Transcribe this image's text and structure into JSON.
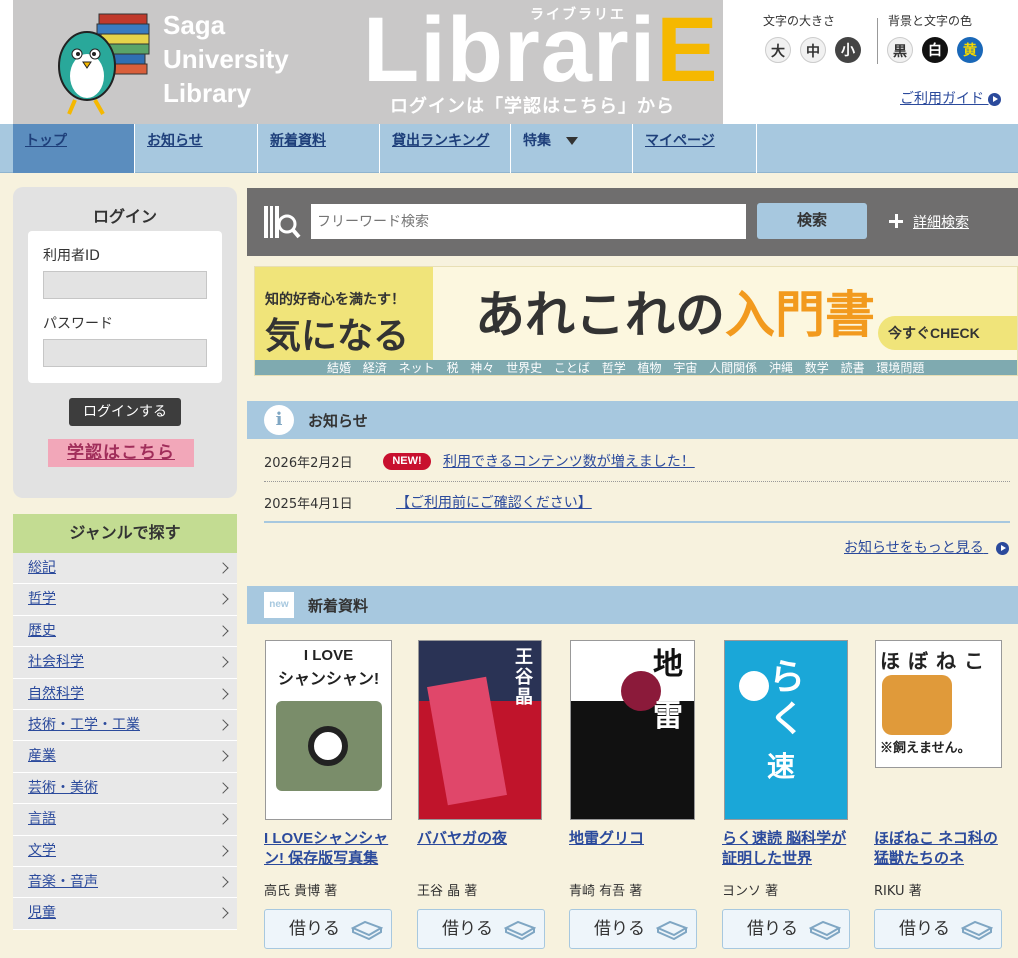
{
  "header": {
    "library_name": [
      "Saga",
      "University",
      "Library"
    ],
    "logo_text": "Librari",
    "logo_e": "E",
    "logo_kana": "ライブラリエ",
    "login_note": "ログインは「学認はこちら」から",
    "font_size_label": "文字の大きさ",
    "font_sizes": [
      "大",
      "中",
      "小"
    ],
    "color_label": "背景と文字の色",
    "colors": [
      "黒",
      "白",
      "黄"
    ],
    "guide_link": "ご利用ガイド"
  },
  "nav": {
    "items": [
      {
        "label": "トップ"
      },
      {
        "label": "お知らせ"
      },
      {
        "label": "新着資料"
      },
      {
        "label": "貸出ランキング"
      },
      {
        "label": "特集"
      },
      {
        "label": "マイページ"
      }
    ]
  },
  "login": {
    "title": "ログイン",
    "user_id_label": "利用者ID",
    "password_label": "パスワード",
    "submit": "ログインする",
    "gakunin": "学認はこちら"
  },
  "genre": {
    "title": "ジャンルで探す",
    "items": [
      "総記",
      "哲学",
      "歴史",
      "社会科学",
      "自然科学",
      "技術・工学・工業",
      "産業",
      "芸術・美術",
      "言語",
      "文学",
      "音楽・音声",
      "児童"
    ]
  },
  "search": {
    "placeholder": "フリーワード検索",
    "button": "検索",
    "advanced": "詳細検索"
  },
  "banner": {
    "sub": "知的好奇心を満たす！",
    "main": "気になる",
    "title_a": "あれこれの",
    "title_b": "入門書",
    "check": "今すぐCHECK",
    "topics": "結婚 経済 ネット 税 神々 世界史 ことば 哲学 植物 宇宙 人間関係 沖縄 数学 読書 環境問題"
  },
  "news": {
    "title": "お知らせ",
    "icon": "i",
    "badge": "NEW!",
    "items": [
      {
        "date": "2026年2月2日",
        "text": "利用できるコンテンツ数が増えました！"
      },
      {
        "date": "2025年4月1日",
        "text": "【ご利用前にご確認ください】"
      }
    ],
    "more": "お知らせをもっと見る"
  },
  "new_arrivals": {
    "title": "新着資料",
    "icon": "new",
    "borrow_label": "借りる",
    "books": [
      {
        "title": "I LOVEシャンシャン! 保存版写真集",
        "author": "高氏 貴博 著",
        "cover_color": "#ffffff"
      },
      {
        "title": "ババヤガの夜",
        "author": "王谷 晶 著",
        "cover_color": "#c0142b"
      },
      {
        "title": "地雷グリコ",
        "author": "青崎 有吾 著",
        "cover_color": "#111111"
      },
      {
        "title": "らく速読 脳科学が証明した世界",
        "author": "ヨンソ 著",
        "cover_color": "#1aa7d8"
      },
      {
        "title": "ほぼねこ ネコ科の猛獣たちのネ",
        "author": "RIKU 著",
        "cover_color": "#ffffff"
      }
    ]
  }
}
